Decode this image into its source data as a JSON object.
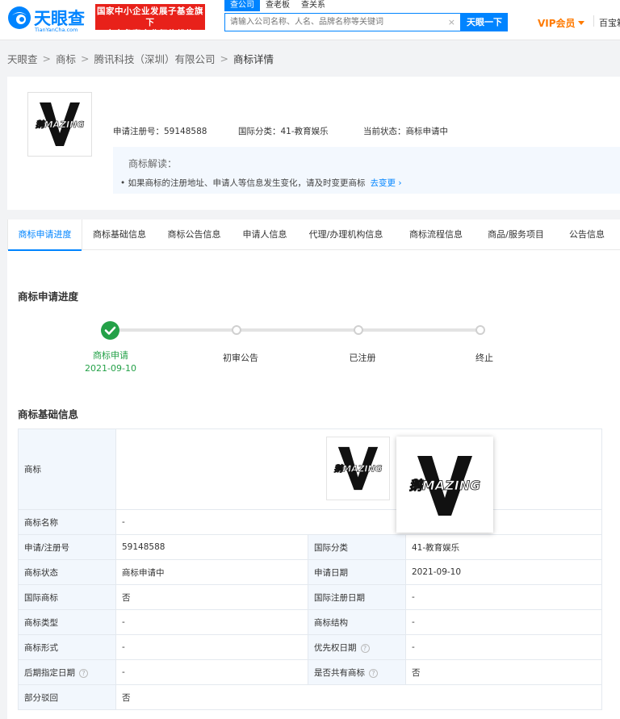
{
  "header": {
    "logo_cn": "天眼查",
    "logo_en": "TianYanCha.com",
    "promo_line1": "国家中小企业发展子基金旗下",
    "promo_line2": "官方备案企业征信机构",
    "search_tabs": [
      "查公司",
      "查老板",
      "查关系"
    ],
    "search_placeholder": "请输入公司名称、人名、品牌名称等关键词",
    "search_clear": "×",
    "search_button": "天眼一下",
    "vip": "VIP会员",
    "more": "百宝箱"
  },
  "breadcrumb": {
    "items": [
      "天眼查",
      "商标",
      "腾讯科技（深圳）有限公司"
    ],
    "separator": ">",
    "current": "商标详情"
  },
  "trademark": {
    "image_text": "鹅MAZING",
    "reg_no_label": "申请注册号：",
    "reg_no": "59148588",
    "class_label": "国际分类：",
    "class_value": "41-教育娱乐",
    "status_label": "当前状态：",
    "status_value": "商标申请中",
    "interpret_title": "商标解读：",
    "interpret_note": "如果商标的注册地址、申请人等信息发生变化，请及时变更商标",
    "interpret_link": "去变更 ›"
  },
  "tabs": [
    "商标申请进度",
    "商标基础信息",
    "商标公告信息",
    "申请人信息",
    "代理/办理机构信息",
    "商标流程信息",
    "商品/服务项目",
    "公告信息"
  ],
  "progress": {
    "title": "商标申请进度",
    "steps": [
      {
        "label": "商标申请",
        "date": "2021-09-10"
      },
      {
        "label": "初审公告"
      },
      {
        "label": "已注册"
      },
      {
        "label": "终止"
      }
    ]
  },
  "basic_info": {
    "title": "商标基础信息",
    "rows": {
      "trademark_label": "商标",
      "name_label": "商标名称",
      "name_value": "-",
      "reg_label": "申请/注册号",
      "reg_value": "59148588",
      "class_label": "国际分类",
      "class_value": "41-教育娱乐",
      "status_label": "商标状态",
      "status_value": "商标申请中",
      "apply_date_label": "申请日期",
      "apply_date_value": "2021-09-10",
      "intl_label": "国际商标",
      "intl_value": "否",
      "intl_date_label": "国际注册日期",
      "intl_date_value": "-",
      "type_label": "商标类型",
      "type_value": "-",
      "structure_label": "商标结构",
      "structure_value": "-",
      "form_label": "商标形式",
      "form_value": "-",
      "priority_label": "优先权日期",
      "priority_value": "-",
      "later_date_label": "后期指定日期",
      "later_date_value": "-",
      "shared_label": "是否共有商标",
      "shared_value": "否",
      "partial_label": "部分驳回",
      "partial_value": "否"
    }
  },
  "colors": {
    "brand_blue": "#0084ff",
    "promo_red": "#e8211a",
    "vip_orange": "#ff7a00",
    "success_green": "#24a148"
  }
}
